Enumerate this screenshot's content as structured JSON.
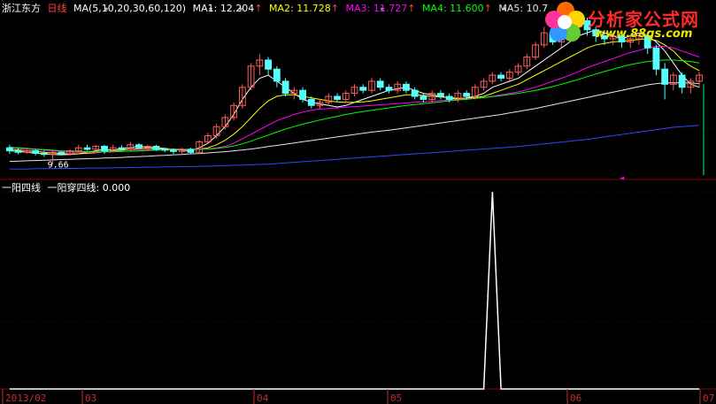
{
  "header": {
    "stock_name": "浙江东方",
    "period": "日线",
    "ma_params": "MA(5,10,20,30,60,120)",
    "ma1_label": "MA1:",
    "ma1_value": "12.204",
    "ma2_label": "MA2:",
    "ma2_value": "11.728",
    "ma3_label": "MA3:",
    "ma3_value": "11.727",
    "ma4_label": "MA4:",
    "ma4_value": "11.600",
    "ma5_label": "MA5:",
    "ma5_value": "10.7",
    "up_arrow": "↑"
  },
  "indicator": {
    "name": "一阳四线",
    "line_label": "一阳穿四线:",
    "line_value": "0.000"
  },
  "watermark": {
    "brand": "分析家公式网",
    "url": "www.88gs.com"
  },
  "colors": {
    "background": "#000000",
    "up_candle": "#ff5a5a",
    "down_candle": "#54ffff",
    "ma1": "#ffffff",
    "ma2": "#ffff00",
    "ma3": "#ff00ff",
    "ma4": "#00ff00",
    "ma5": "#e6e6e6",
    "ma6": "#3344ff",
    "grid": "#8b0000",
    "indicator_line": "#ffffff"
  },
  "chart_data": [
    {
      "type": "candlestick",
      "title": "",
      "low_marker_label": "9.66",
      "ylim": [
        9.3,
        14.5
      ],
      "dates": [
        "2013/02",
        "03",
        "04",
        "05",
        "06",
        "07"
      ],
      "series": [
        {
          "name": "MA1",
          "values": [
            10.1,
            10.08,
            10.05,
            10.02,
            10.0,
            9.98,
            9.97,
            9.98,
            10.0,
            10.05,
            10.1,
            10.15,
            10.12,
            10.18,
            10.2,
            10.25,
            10.22,
            10.2,
            10.18,
            10.15,
            10.12,
            10.1,
            10.2,
            10.35,
            10.6,
            10.9,
            11.3,
            11.8,
            12.2,
            12.5,
            12.6,
            12.4,
            12.2,
            12.0,
            11.8,
            11.7,
            11.65,
            11.6,
            11.55,
            11.6,
            11.7,
            11.8,
            11.9,
            12.0,
            12.1,
            12.15,
            12.2,
            12.1,
            12.0,
            11.95,
            11.9,
            11.85,
            11.8,
            11.85,
            11.9,
            12.0,
            12.2,
            12.3,
            12.4,
            12.5,
            12.7,
            12.9,
            13.1,
            13.3,
            13.5,
            13.7,
            13.9,
            14.0,
            14.1,
            14.0,
            13.9,
            13.8,
            13.9,
            14.0,
            13.9,
            13.7,
            13.4,
            13.0,
            12.6,
            12.3,
            12.2
          ]
        },
        {
          "name": "MA2",
          "values": [
            10.15,
            10.13,
            10.1,
            10.08,
            10.05,
            10.03,
            10.01,
            10.0,
            10.0,
            10.02,
            10.04,
            10.07,
            10.1,
            10.12,
            10.15,
            10.17,
            10.18,
            10.18,
            10.17,
            10.16,
            10.15,
            10.14,
            10.15,
            10.2,
            10.3,
            10.45,
            10.65,
            10.9,
            11.2,
            11.5,
            11.75,
            11.9,
            11.95,
            11.95,
            11.9,
            11.85,
            11.8,
            11.75,
            11.72,
            11.7,
            11.7,
            11.72,
            11.75,
            11.8,
            11.85,
            11.9,
            11.95,
            11.95,
            11.93,
            11.9,
            11.88,
            11.86,
            11.84,
            11.84,
            11.86,
            11.9,
            12.0,
            12.1,
            12.2,
            12.3,
            12.45,
            12.6,
            12.75,
            12.9,
            13.05,
            13.2,
            13.35,
            13.5,
            13.6,
            13.65,
            13.7,
            13.72,
            13.75,
            13.78,
            13.8,
            13.75,
            13.6,
            13.4,
            13.1,
            12.9,
            12.75
          ]
        },
        {
          "name": "MA3",
          "values": [
            10.2,
            10.18,
            10.16,
            10.14,
            10.12,
            10.1,
            10.08,
            10.06,
            10.05,
            10.05,
            10.05,
            10.06,
            10.07,
            10.08,
            10.1,
            10.12,
            10.13,
            10.14,
            10.15,
            10.15,
            10.15,
            10.15,
            10.15,
            10.17,
            10.2,
            10.25,
            10.35,
            10.5,
            10.65,
            10.8,
            10.95,
            11.1,
            11.2,
            11.3,
            11.38,
            11.44,
            11.48,
            11.5,
            11.52,
            11.54,
            11.56,
            11.58,
            11.6,
            11.62,
            11.64,
            11.66,
            11.68,
            11.7,
            11.72,
            11.74,
            11.76,
            11.78,
            11.8,
            11.82,
            11.84,
            11.86,
            11.9,
            11.95,
            12.0,
            12.05,
            12.12,
            12.2,
            12.3,
            12.4,
            12.5,
            12.6,
            12.72,
            12.85,
            12.95,
            13.05,
            13.15,
            13.25,
            13.35,
            13.42,
            13.5,
            13.55,
            13.55,
            13.5,
            13.4,
            13.3,
            13.2
          ]
        },
        {
          "name": "MA4",
          "values": [
            10.22,
            10.2,
            10.18,
            10.16,
            10.14,
            10.12,
            10.1,
            10.09,
            10.08,
            10.07,
            10.07,
            10.07,
            10.07,
            10.08,
            10.09,
            10.1,
            10.11,
            10.12,
            10.13,
            10.14,
            10.14,
            10.15,
            10.15,
            10.16,
            10.18,
            10.21,
            10.26,
            10.33,
            10.42,
            10.52,
            10.62,
            10.72,
            10.82,
            10.9,
            10.98,
            11.05,
            11.12,
            11.18,
            11.24,
            11.3,
            11.35,
            11.4,
            11.44,
            11.48,
            11.52,
            11.56,
            11.6,
            11.63,
            11.66,
            11.69,
            11.72,
            11.75,
            11.78,
            11.8,
            11.83,
            11.86,
            11.89,
            11.92,
            11.96,
            12.0,
            12.05,
            12.1,
            12.16,
            12.22,
            12.3,
            12.38,
            12.46,
            12.55,
            12.64,
            12.72,
            12.8,
            12.88,
            12.95,
            13.0,
            13.05,
            13.08,
            13.1,
            13.1,
            13.08,
            13.05,
            13.0
          ]
        },
        {
          "name": "MA5",
          "values": [
            9.75,
            9.76,
            9.77,
            9.78,
            9.79,
            9.8,
            9.81,
            9.82,
            9.83,
            9.84,
            9.85,
            9.86,
            9.87,
            9.88,
            9.9,
            9.91,
            9.92,
            9.94,
            9.95,
            9.97,
            9.98,
            10.0,
            10.01,
            10.03,
            10.05,
            10.07,
            10.1,
            10.13,
            10.16,
            10.2,
            10.24,
            10.28,
            10.32,
            10.36,
            10.4,
            10.44,
            10.48,
            10.52,
            10.56,
            10.6,
            10.64,
            10.68,
            10.72,
            10.75,
            10.78,
            10.82,
            10.86,
            10.9,
            10.94,
            10.98,
            11.02,
            11.06,
            11.1,
            11.14,
            11.18,
            11.22,
            11.26,
            11.3,
            11.35,
            11.4,
            11.45,
            11.5,
            11.56,
            11.62,
            11.68,
            11.74,
            11.8,
            11.86,
            11.92,
            11.98,
            12.04,
            12.1,
            12.16,
            12.22,
            12.28,
            12.32,
            12.34,
            12.35,
            12.35,
            12.34,
            12.32
          ]
        },
        {
          "name": "MA6",
          "values": [
            9.5,
            9.5,
            9.5,
            9.51,
            9.51,
            9.51,
            9.52,
            9.52,
            9.52,
            9.53,
            9.53,
            9.53,
            9.54,
            9.54,
            9.55,
            9.55,
            9.56,
            9.56,
            9.57,
            9.57,
            9.58,
            9.58,
            9.59,
            9.59,
            9.6,
            9.61,
            9.62,
            9.63,
            9.64,
            9.65,
            9.66,
            9.68,
            9.7,
            9.72,
            9.74,
            9.76,
            9.78,
            9.8,
            9.82,
            9.84,
            9.86,
            9.88,
            9.9,
            9.92,
            9.94,
            9.96,
            9.98,
            10.0,
            10.02,
            10.04,
            10.06,
            10.08,
            10.1,
            10.12,
            10.14,
            10.16,
            10.18,
            10.2,
            10.22,
            10.24,
            10.27,
            10.3,
            10.33,
            10.36,
            10.39,
            10.42,
            10.45,
            10.48,
            10.52,
            10.56,
            10.6,
            10.64,
            10.68,
            10.72,
            10.76,
            10.8,
            10.84,
            10.88,
            10.9,
            10.92,
            10.94
          ]
        }
      ],
      "candles": [
        [
          10.2,
          10.1,
          10.3,
          10.0
        ],
        [
          10.1,
          10.05,
          10.2,
          9.98
        ],
        [
          10.05,
          10.1,
          10.2,
          10.0
        ],
        [
          10.1,
          10.02,
          10.15,
          9.95
        ],
        [
          10.02,
          9.98,
          10.1,
          9.9
        ],
        [
          9.98,
          10.05,
          10.1,
          9.66
        ],
        [
          10.05,
          10.0,
          10.1,
          9.95
        ],
        [
          10.0,
          10.1,
          10.15,
          9.95
        ],
        [
          10.1,
          10.2,
          10.3,
          10.05
        ],
        [
          10.2,
          10.15,
          10.3,
          10.1
        ],
        [
          10.15,
          10.25,
          10.3,
          10.1
        ],
        [
          10.25,
          10.1,
          10.3,
          10.0
        ],
        [
          10.1,
          10.2,
          10.3,
          10.05
        ],
        [
          10.2,
          10.15,
          10.28,
          10.1
        ],
        [
          10.15,
          10.3,
          10.4,
          10.1
        ],
        [
          10.3,
          10.2,
          10.35,
          10.15
        ],
        [
          10.2,
          10.25,
          10.3,
          10.1
        ],
        [
          10.25,
          10.15,
          10.3,
          10.1
        ],
        [
          10.15,
          10.12,
          10.2,
          10.05
        ],
        [
          10.12,
          10.08,
          10.18,
          10.0
        ],
        [
          10.08,
          10.15,
          10.2,
          10.0
        ],
        [
          10.15,
          10.05,
          10.2,
          10.0
        ],
        [
          10.05,
          10.4,
          10.45,
          10.0
        ],
        [
          10.4,
          10.6,
          10.7,
          10.35
        ],
        [
          10.6,
          10.9,
          11.0,
          10.5
        ],
        [
          10.9,
          11.2,
          11.3,
          10.8
        ],
        [
          11.2,
          11.6,
          11.7,
          11.1
        ],
        [
          11.6,
          12.2,
          12.3,
          11.5
        ],
        [
          12.2,
          12.9,
          13.0,
          12.1
        ],
        [
          12.9,
          13.1,
          13.3,
          12.6
        ],
        [
          13.1,
          12.8,
          13.2,
          12.6
        ],
        [
          12.8,
          12.4,
          12.9,
          12.2
        ],
        [
          12.4,
          12.0,
          12.5,
          11.9
        ],
        [
          12.0,
          12.1,
          12.2,
          11.8
        ],
        [
          12.1,
          11.8,
          12.2,
          11.7
        ],
        [
          11.8,
          11.6,
          11.9,
          11.5
        ],
        [
          11.6,
          11.7,
          11.8,
          11.5
        ],
        [
          11.7,
          11.9,
          12.0,
          11.6
        ],
        [
          11.9,
          11.8,
          12.0,
          11.7
        ],
        [
          11.8,
          12.0,
          12.1,
          11.7
        ],
        [
          12.0,
          12.2,
          12.3,
          11.9
        ],
        [
          12.2,
          12.1,
          12.3,
          12.0
        ],
        [
          12.1,
          12.4,
          12.5,
          12.0
        ],
        [
          12.4,
          12.2,
          12.5,
          12.1
        ],
        [
          12.2,
          12.1,
          12.3,
          12.0
        ],
        [
          12.1,
          12.3,
          12.4,
          12.0
        ],
        [
          12.3,
          12.1,
          12.4,
          12.0
        ],
        [
          12.1,
          11.9,
          12.2,
          11.8
        ],
        [
          11.9,
          11.8,
          12.0,
          11.7
        ],
        [
          11.8,
          12.0,
          12.1,
          11.7
        ],
        [
          12.0,
          11.9,
          12.1,
          11.8
        ],
        [
          11.9,
          11.8,
          12.0,
          11.7
        ],
        [
          11.8,
          12.0,
          12.1,
          11.7
        ],
        [
          12.0,
          11.9,
          12.1,
          11.8
        ],
        [
          11.9,
          12.2,
          12.3,
          11.8
        ],
        [
          12.2,
          12.4,
          12.5,
          12.1
        ],
        [
          12.4,
          12.6,
          12.7,
          12.3
        ],
        [
          12.6,
          12.5,
          12.7,
          12.4
        ],
        [
          12.5,
          12.7,
          12.8,
          12.4
        ],
        [
          12.7,
          12.9,
          13.0,
          12.6
        ],
        [
          12.9,
          13.2,
          13.3,
          12.8
        ],
        [
          13.2,
          13.6,
          13.7,
          13.1
        ],
        [
          13.6,
          14.0,
          14.2,
          13.5
        ],
        [
          14.0,
          13.7,
          14.1,
          13.6
        ],
        [
          13.7,
          13.9,
          14.0,
          13.5
        ],
        [
          13.9,
          14.2,
          14.3,
          13.8
        ],
        [
          14.2,
          14.4,
          14.5,
          14.0
        ],
        [
          14.4,
          14.1,
          14.5,
          13.9
        ],
        [
          14.1,
          13.9,
          14.2,
          13.7
        ],
        [
          13.9,
          13.8,
          14.0,
          13.6
        ],
        [
          13.8,
          13.9,
          14.0,
          13.6
        ],
        [
          13.9,
          13.7,
          14.0,
          13.5
        ],
        [
          13.7,
          13.8,
          13.9,
          13.5
        ],
        [
          13.8,
          13.9,
          14.0,
          13.6
        ],
        [
          13.9,
          13.5,
          14.0,
          13.3
        ],
        [
          13.5,
          12.8,
          13.6,
          12.6
        ],
        [
          12.8,
          12.3,
          13.0,
          11.8
        ],
        [
          12.3,
          12.6,
          12.7,
          12.1
        ],
        [
          12.6,
          12.2,
          12.7,
          12.0
        ],
        [
          12.2,
          12.4,
          12.5,
          12.0
        ],
        [
          12.4,
          12.6,
          12.7,
          12.2
        ]
      ]
    },
    {
      "type": "line",
      "title": "",
      "series": [
        {
          "name": "一阳穿四线",
          "values": [
            0,
            0,
            0,
            0,
            0,
            0,
            0,
            0,
            0,
            0,
            0,
            0,
            0,
            0,
            0,
            0,
            0,
            0,
            0,
            0,
            0,
            0,
            0,
            0,
            0,
            0,
            0,
            0,
            0,
            0,
            0,
            0,
            0,
            0,
            0,
            0,
            0,
            0,
            0,
            0,
            0,
            0,
            0,
            0,
            0,
            0,
            0,
            0,
            0,
            0,
            0,
            0,
            0,
            0,
            0,
            0,
            1,
            0,
            0,
            0,
            0,
            0,
            0,
            0,
            0,
            0,
            0,
            0,
            0,
            0,
            0,
            0,
            0,
            0,
            0,
            0,
            0,
            0,
            0,
            0,
            0
          ]
        }
      ],
      "ylim": [
        0,
        1
      ]
    }
  ]
}
